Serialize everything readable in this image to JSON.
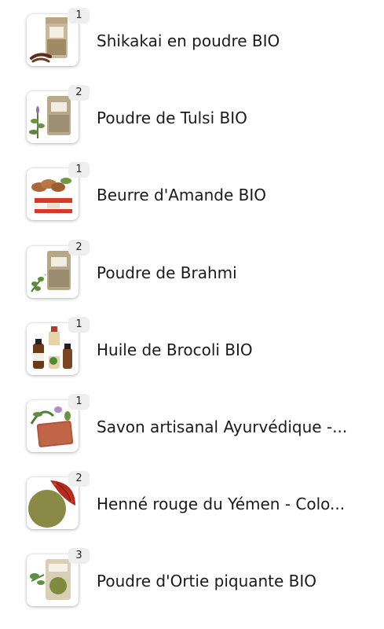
{
  "cart": {
    "items": [
      {
        "qty": "1",
        "name": "Shikakai en poudre BIO",
        "image": "shikakai-powder-pouch"
      },
      {
        "qty": "2",
        "name": "Poudre de Tulsi BIO",
        "image": "tulsi-powder-pouch"
      },
      {
        "qty": "1",
        "name": "Beurre d'Amande BIO",
        "image": "almond-butter-jar"
      },
      {
        "qty": "2",
        "name": "Poudre de Brahmi",
        "image": "brahmi-powder-pouch"
      },
      {
        "qty": "1",
        "name": "Huile de Brocoli BIO",
        "image": "broccoli-oil-bottles"
      },
      {
        "qty": "1",
        "name": "Savon artisanal Ayurvédique -...",
        "image": "ayurvedic-soap-bar"
      },
      {
        "qty": "2",
        "name": "Henné rouge du Yémen - Colo...",
        "image": "red-henna-powder"
      },
      {
        "qty": "3",
        "name": "Poudre d'Ortie piquante BIO",
        "image": "nettle-powder-pouch"
      }
    ]
  },
  "colors": {
    "badge_bg": "#eeeeee",
    "text": "#1a1a1a"
  }
}
